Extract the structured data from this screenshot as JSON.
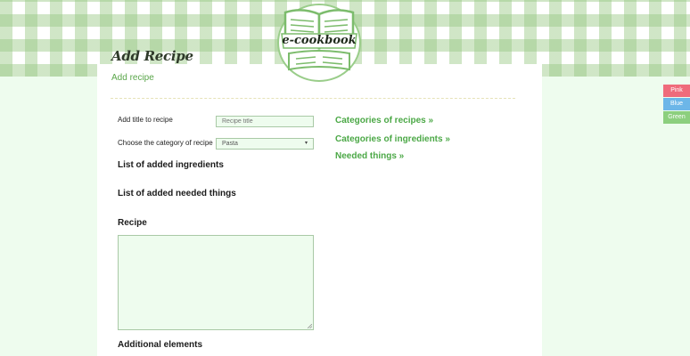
{
  "header": {
    "logo_text": "e-cookbook"
  },
  "page": {
    "heading": "Add Recipe",
    "breadcrumb": "Add recipe"
  },
  "form": {
    "title_label": "Add title to recipe",
    "title_placeholder": "Recipe title",
    "category_label": "Choose the category of recipe",
    "category_selected": "Pasta",
    "ingredients_title": "List of added ingredients",
    "needed_title": "List of added needed things",
    "recipe_title": "Recipe",
    "additional_title": "Additional elements"
  },
  "side_links": {
    "categories_recipes": "Categories of recipes »",
    "categories_ingredients": "Categories of ingredients »",
    "needed_things": "Needed things »"
  },
  "theme_switcher": [
    {
      "label": "Pink",
      "color": "#ef6b7b"
    },
    {
      "label": "Blue",
      "color": "#6cb6e8"
    },
    {
      "label": "Green",
      "color": "#8ccf7e"
    }
  ],
  "colors": {
    "accent": "#4ba846",
    "background": "#eefcee",
    "gingham": "#96c882"
  }
}
